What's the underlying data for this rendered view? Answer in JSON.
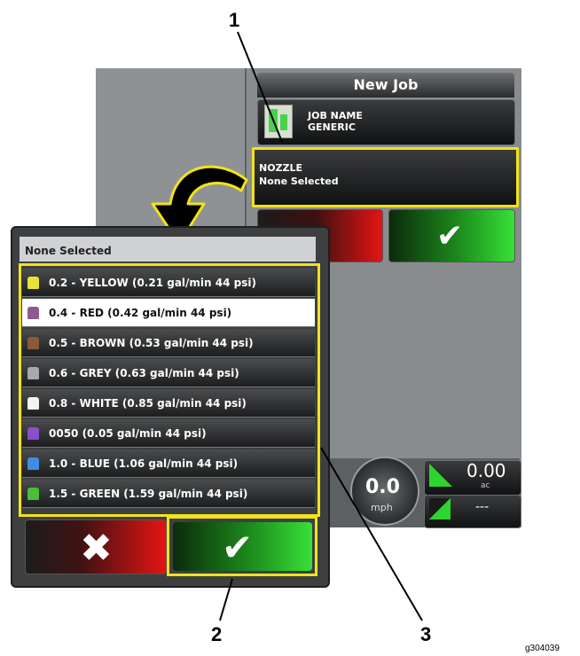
{
  "background": {
    "new_job_title": "New Job",
    "job_name_label": "JOB NAME",
    "job_name_value": "GENERIC",
    "nozzle_label": "NOZZLE",
    "nozzle_value": "None Selected",
    "speed_value": "0.0",
    "speed_unit": "mph",
    "area_value": "0.00",
    "area_unit": "ac",
    "rate_value": "---"
  },
  "popup": {
    "header": "None Selected",
    "items": [
      {
        "label": "0.2 - YELLOW (0.21 gal/min 44 psi)",
        "icon": "nozzle-yellow-icon",
        "color": "#e9e23a",
        "selected": false
      },
      {
        "label": "0.4 - RED (0.42 gal/min 44 psi)",
        "icon": "nozzle-red-icon",
        "color": "#8e5a8e",
        "selected": true
      },
      {
        "label": "0.5 - BROWN (0.53 gal/min 44 psi)",
        "icon": "nozzle-brown-icon",
        "color": "#8a5a3a",
        "selected": false
      },
      {
        "label": "0.6 - GREY (0.63 gal/min 44 psi)",
        "icon": "nozzle-grey-icon",
        "color": "#a7a9ab",
        "selected": false
      },
      {
        "label": "0.8 - WHITE (0.85 gal/min 44 psi)",
        "icon": "nozzle-white-icon",
        "color": "#f2f2f2",
        "selected": false
      },
      {
        "label": "0050 (0.05 gal/min 44 psi)",
        "icon": "nozzle-purple-icon",
        "color": "#8a4fc9",
        "selected": false
      },
      {
        "label": "1.0 - BLUE (1.06 gal/min 44 psi)",
        "icon": "nozzle-blue-icon",
        "color": "#3f8de0",
        "selected": false
      },
      {
        "label": "1.5 - GREEN (1.59 gal/min 44 psi)",
        "icon": "nozzle-green-icon",
        "color": "#4bbf3c",
        "selected": false
      }
    ]
  },
  "colors": {
    "highlight": "#f2e21b",
    "ok": "#38e038",
    "cancel": "#e51414"
  },
  "callouts": {
    "one": "1",
    "two": "2",
    "three": "3"
  },
  "figure_id": "g304039"
}
